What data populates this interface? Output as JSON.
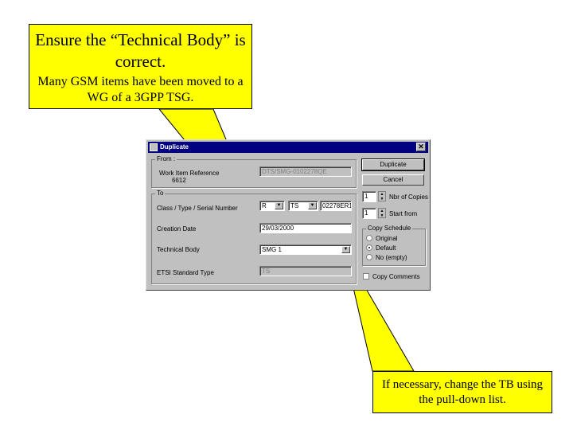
{
  "callouts": {
    "top": {
      "heading": "Ensure the “Technical Body” is correct.",
      "body": "Many GSM items have been moved to a WG of a 3GPP TSG."
    },
    "bottom": {
      "text": "If necessary, change the TB using the pull-down list."
    }
  },
  "dialog": {
    "title": "Duplicate",
    "close": "✕",
    "from": {
      "group_label": "From :",
      "work_item_label": "Work Item Reference",
      "work_item_value": "DTS/SMG-0102278QE",
      "work_item_number": "6612"
    },
    "to": {
      "group_label": "To",
      "class_type_serial_label": "Class / Type / Serial Number",
      "class_value": "R",
      "type_value": "TS",
      "serial_value": "02278ER1",
      "creation_date_label": "Creation Date",
      "creation_date_value": "29/03/2000",
      "technical_body_label": "Technical Body",
      "technical_body_value": "SMG 1",
      "standard_type_label": "ETSI Standard Type",
      "standard_type_value": "TS"
    },
    "buttons": {
      "duplicate": "Duplicate",
      "cancel": "Cancel"
    },
    "copies": {
      "num_value": "1",
      "num_label": "Nbr of Copies",
      "start_value": "1",
      "start_label": "Start from"
    },
    "copy_schedule": {
      "group_label": "Copy Schedule",
      "options": [
        "Original",
        "Default",
        "No (empty)"
      ],
      "selected": "Default"
    },
    "copy_comments_label": "Copy Comments"
  }
}
